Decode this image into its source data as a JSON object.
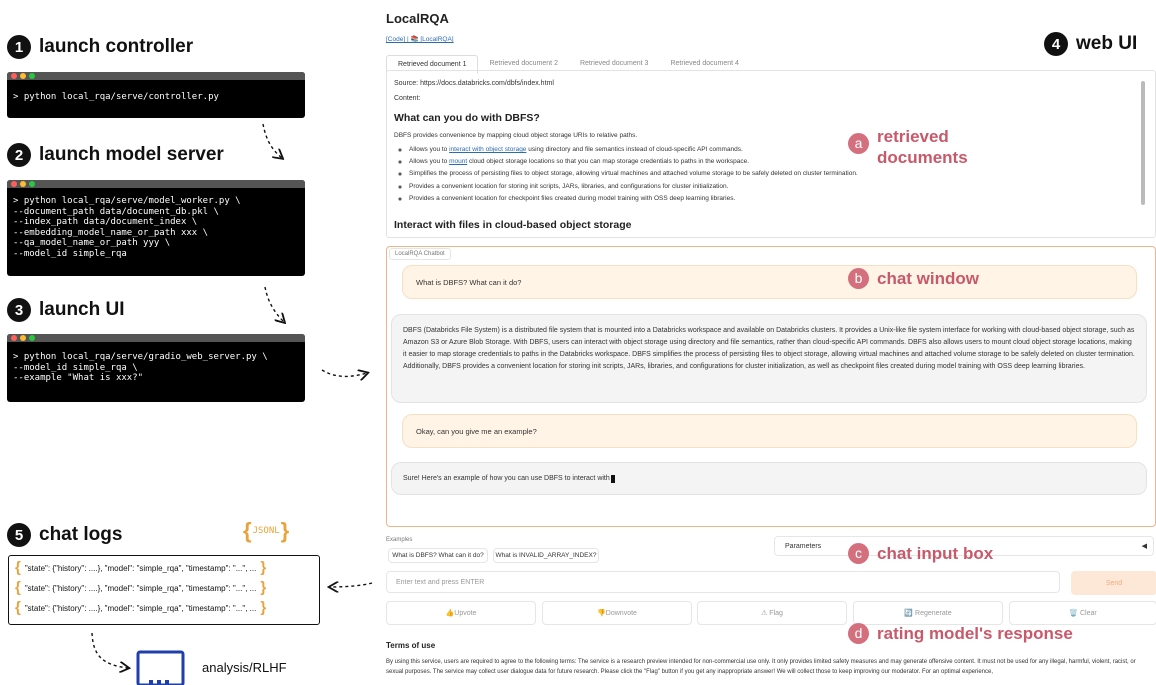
{
  "steps": {
    "s1": {
      "num": "1",
      "label": "launch controller"
    },
    "s2": {
      "num": "2",
      "label": "launch model server"
    },
    "s3": {
      "num": "3",
      "label": "launch UI"
    },
    "s4": {
      "num": "4",
      "label": "web UI"
    },
    "s5": {
      "num": "5",
      "label": "chat logs"
    }
  },
  "terminals": {
    "t1": "> python local_rqa/serve/controller.py",
    "t2": "> python local_rqa/serve/model_worker.py \\\n--document_path data/document_db.pkl \\\n--index_path data/document_index \\\n--embedding_model_name_or_path xxx \\\n--qa_model_name_or_path yyy \\\n--model_id simple_rqa",
    "t3": "> python local_rqa/serve/gradio_web_server.py \\\n--model_id simple_rqa \\\n--example \"What is xxx?\""
  },
  "colors": {
    "accent": "#c8596a",
    "json_brace": "#e8a33c",
    "chat_border": "#f0b48a"
  },
  "ui": {
    "title": "LocalRQA",
    "links": "[Code] | 📚 [LocalRQA]",
    "tabs": [
      "Retrieved document 1",
      "Retrieved document 2",
      "Retrieved document 3",
      "Retrieved document 4"
    ],
    "doc": {
      "source": "Source: https://docs.databricks.com/dbfs/index.html",
      "content_label": "Content:",
      "heading1": "What can you do with DBFS?",
      "intro": "DBFS provides convenience by mapping cloud object storage URIs to relative paths.",
      "b1_pre": "Allows you to ",
      "b1_link": "interact with object storage",
      "b1_post": " using directory and file semantics instead of cloud-specific API commands.",
      "b2_pre": "Allows you to ",
      "b2_link": "mount",
      "b2_post": " cloud object storage locations so that you can map storage credentials to paths in the workspace.",
      "b3": "Simplifies the process of persisting files to object storage, allowing virtual machines and attached volume storage to be safely deleted on cluster termination.",
      "b4": "Provides a convenient location for storing init scripts, JARs, libraries, and configurations for cluster initialization.",
      "b5": "Provides a convenient location for checkpoint files created during model training with OSS deep learning libraries.",
      "heading2": "Interact with files in cloud-based object storage"
    },
    "chat": {
      "label": "LocalRQA Chatbot",
      "q1": "What is DBFS? What can it do?",
      "a1": "DBFS (Databricks File System) is a distributed file system that is mounted into a Databricks workspace and available on Databricks clusters. It provides a Unix-like file system interface for working with cloud-based object storage, such as Amazon S3 or Azure Blob Storage. With DBFS, users can interact with object storage using directory and file semantics, rather than cloud-specific API commands. DBFS also allows users to mount cloud object storage locations, making it easier to map storage credentials to paths in the Databricks workspace. DBFS simplifies the process of persisting files to object storage, allowing virtual machines and attached volume storage to be safely deleted on cluster termination. Additionally, DBFS provides a convenient location for storing init scripts, JARs, libraries, and configurations for cluster initialization, as well as checkpoint files created during model training with OSS deep learning libraries.",
      "q2": "Okay, can you give me an example?",
      "a2": "Sure! Here's an example of how you can use DBFS to interact with"
    },
    "examples_label": "Examples",
    "examples": [
      "What is DBFS? What can it do?",
      "What is INVALID_ARRAY_INDEX?"
    ],
    "parameters_label": "Parameters",
    "input_placeholder": "Enter text and press ENTER",
    "send_label": "Send",
    "buttons": {
      "upvote": "👍Upvote",
      "downvote": "👎Downvote",
      "flag": "⚠ Flag",
      "regenerate": "🔄 Regenerate",
      "clear": "🗑️ Clear"
    },
    "terms_title": "Terms of use",
    "terms_text": "By using this service, users are required to agree to the following terms: The service is a research preview intended for non-commercial use only. It only provides limited safety measures and may generate offensive content. It must not be used for any illegal, harmful, violent, racist, or sexual purposes. The service may collect user dialogue data for future research. Please click the \"Flag\" button if you get any inappropriate answer! We will collect those to keep improving our moderator. For an optimal experience,"
  },
  "annotations": {
    "a": {
      "letter": "a",
      "line1": "retrieved",
      "line2": "documents"
    },
    "b": {
      "letter": "b",
      "label": "chat window"
    },
    "c": {
      "letter": "c",
      "label": "chat input box"
    },
    "d": {
      "letter": "d",
      "label": "rating model's response"
    }
  },
  "logs": {
    "badge": "JSONL",
    "row": "\"state\": {\"history\": ....}, \"model\": \"simple_rqa\", \"timestamp\": \"...\", ..."
  },
  "analysis_label": "analysis/RLHF"
}
